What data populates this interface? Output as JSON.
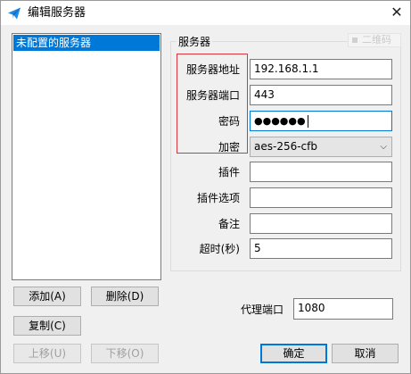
{
  "window": {
    "title": "编辑服务器",
    "close_glyph": "✕"
  },
  "server_list": {
    "items": [
      "未配置的服务器"
    ]
  },
  "left_buttons": {
    "add": "添加(A)",
    "delete": "删除(D)",
    "copy": "复制(C)",
    "move_up": "上移(U)",
    "move_down": "下移(O)"
  },
  "server_group": {
    "title": "服务器",
    "qr_label": "二维码",
    "fields": {
      "address": {
        "label": "服务器地址",
        "value": "192.168.1.1"
      },
      "port": {
        "label": "服务器端口",
        "value": "443"
      },
      "password": {
        "label": "密码",
        "value": "●●●●●●"
      },
      "encryption": {
        "label": "加密",
        "value": "aes-256-cfb"
      },
      "plugin": {
        "label": "插件",
        "value": ""
      },
      "plugin_options": {
        "label": "插件选项",
        "value": ""
      },
      "remarks": {
        "label": "备注",
        "value": ""
      },
      "timeout": {
        "label": "超时(秒)",
        "value": "5"
      }
    }
  },
  "proxy": {
    "label": "代理端口",
    "value": "1080"
  },
  "dialog_buttons": {
    "ok": "确定",
    "cancel": "取消"
  },
  "colors": {
    "selection": "#0078d7",
    "highlight_box": "#d9363e",
    "accent_icon": "#1e88e5"
  },
  "icons": {
    "app": "paper-plane-icon",
    "close": "close-icon",
    "dropdown": "chevron-down-icon",
    "qr": "qr-code-icon"
  }
}
